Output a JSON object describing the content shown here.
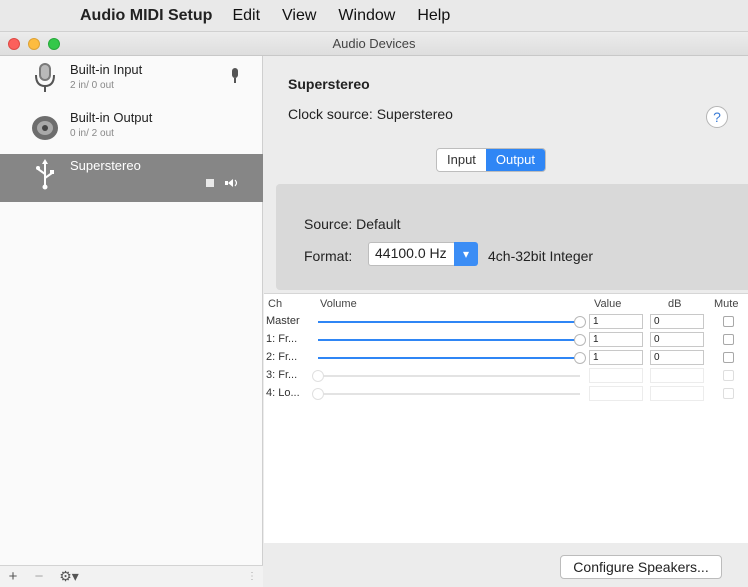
{
  "menubar": {
    "app_name": "Audio MIDI Setup",
    "items": [
      "Edit",
      "View",
      "Window",
      "Help"
    ]
  },
  "window": {
    "title": "Audio Devices"
  },
  "devices": [
    {
      "name": "Built-in Input",
      "detail": "2 in/ 0 out",
      "icon": "microphone-icon",
      "status_icon": "microphone-icon"
    },
    {
      "name": "Built-in Output",
      "detail": "0 in/ 2 out",
      "icon": "speaker-icon"
    },
    {
      "name": "Superstereo",
      "detail": "",
      "icon": "usb-icon",
      "status_icon": "speaker-volume-icon",
      "selected": true
    }
  ],
  "sidebar_footer": {
    "add": "+",
    "remove": "−",
    "actions": "⚙▾"
  },
  "device_header": {
    "title": "Superstereo",
    "clock_source": "Clock source: Superstereo",
    "help": "?"
  },
  "tabs": [
    "Input",
    "Output"
  ],
  "active_tab": "Output",
  "stream": {
    "source": "Source: Default",
    "format_label": "Format:",
    "format_rate": "44100.0 Hz",
    "format_type": "4ch-32bit Integer"
  },
  "channel_table": {
    "headers": {
      "ch": "Ch",
      "volume": "Volume",
      "value": "Value",
      "db": "dB",
      "mute": "Mute"
    },
    "rows": [
      {
        "ch": "Master",
        "volume": 1,
        "value": "1",
        "db": "0",
        "enabled": true
      },
      {
        "ch": "1: Fr...",
        "volume": 1,
        "value": "1",
        "db": "0",
        "enabled": true
      },
      {
        "ch": "2: Fr...",
        "volume": 1,
        "value": "1",
        "db": "0",
        "enabled": true
      },
      {
        "ch": "3: Fr...",
        "volume": 0,
        "value": "",
        "db": "",
        "enabled": false
      },
      {
        "ch": "4: Lo...",
        "volume": 0,
        "value": "",
        "db": "",
        "enabled": false
      }
    ]
  },
  "configure_button": "Configure Speakers...",
  "colors": {
    "accent": "#2f86f5",
    "selection": "#868686"
  }
}
